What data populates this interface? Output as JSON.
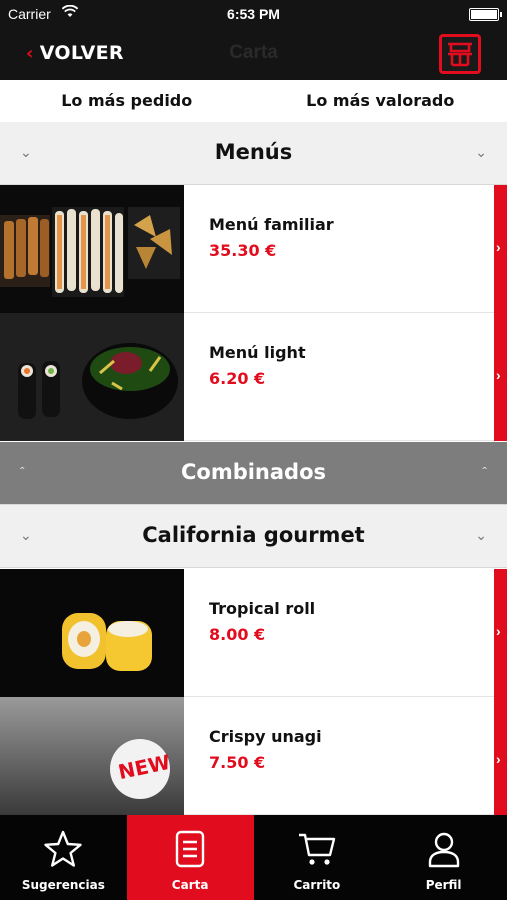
{
  "status_bar": {
    "carrier": "Carrier",
    "time": "6:53 PM"
  },
  "nav": {
    "back_label": "VOLVER",
    "title": "Carta"
  },
  "tabs": [
    {
      "label": "Lo más pedido"
    },
    {
      "label": "Lo más valorado"
    }
  ],
  "sections": [
    {
      "title": "Menús",
      "items": [
        {
          "name": "Menú familiar",
          "price": "35.30 €"
        },
        {
          "name": "Menú light",
          "price": "6.20 €"
        }
      ]
    },
    {
      "title": "Combinados"
    },
    {
      "title": "California gourmet",
      "items": [
        {
          "name": "Tropical roll",
          "price": "8.00 €"
        },
        {
          "name": "Crispy unagi",
          "price": "7.50 €",
          "badge": "NEW"
        }
      ]
    }
  ],
  "tab_bar": [
    {
      "label": "Sugerencias",
      "icon": "star-icon"
    },
    {
      "label": "Carta",
      "icon": "menu-list-icon",
      "active": true
    },
    {
      "label": "Carrito",
      "icon": "cart-icon"
    },
    {
      "label": "Perfil",
      "icon": "user-icon"
    }
  ],
  "colors": {
    "accent": "#e10d1e",
    "bar": "#141414",
    "section_light": "#f0f0f0",
    "section_dark": "#7d7d7d"
  }
}
